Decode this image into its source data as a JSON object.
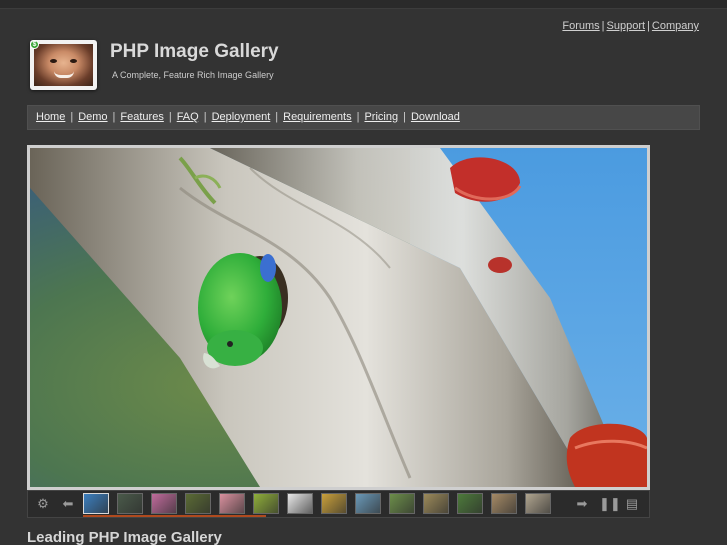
{
  "top_links": [
    {
      "label": "Forums"
    },
    {
      "label": "Support"
    },
    {
      "label": "Company"
    }
  ],
  "site": {
    "title": "PHP Image Gallery",
    "subtitle": "A Complete, Feature Rich Image Gallery"
  },
  "nav": [
    {
      "label": "Home"
    },
    {
      "label": "Demo"
    },
    {
      "label": "Features"
    },
    {
      "label": "FAQ"
    },
    {
      "label": "Deployment"
    },
    {
      "label": "Requirements"
    },
    {
      "label": "Pricing"
    },
    {
      "label": "Download"
    }
  ],
  "gallery": {
    "main_image": "green parrot on tree trunk with red bracket fungus",
    "controls": {
      "left": [
        "gear-icon",
        "arrow-left-icon"
      ],
      "right": [
        "arrow-right-icon",
        "pause-icon",
        "filmstrip-icon"
      ]
    },
    "thumbnails": [
      {
        "name": "blue-bird",
        "color": "#3c7fbf"
      },
      {
        "name": "sleeping-animal",
        "color": "#4a5a4a"
      },
      {
        "name": "pink-flower",
        "color": "#c06b9c"
      },
      {
        "name": "lizard",
        "color": "#5b6b35"
      },
      {
        "name": "pink-lily",
        "color": "#d9909e"
      },
      {
        "name": "green-grasshopper",
        "color": "#8fae3a"
      },
      {
        "name": "black-white-bird",
        "color": "#e7e7e7"
      },
      {
        "name": "yellow-fish",
        "color": "#c9a03b"
      },
      {
        "name": "shark",
        "color": "#6a99b8"
      },
      {
        "name": "frog-tree",
        "color": "#6c8e4a"
      },
      {
        "name": "owl-face",
        "color": "#9c8a5a"
      },
      {
        "name": "chameleon",
        "color": "#4d7a3b"
      },
      {
        "name": "meerkat",
        "color": "#a58a66"
      },
      {
        "name": "heron",
        "color": "#b0a58f"
      }
    ],
    "active_thumbnail_index": 0,
    "progress_fraction": 0.39
  },
  "content": {
    "heading": "Leading PHP Image Gallery"
  }
}
